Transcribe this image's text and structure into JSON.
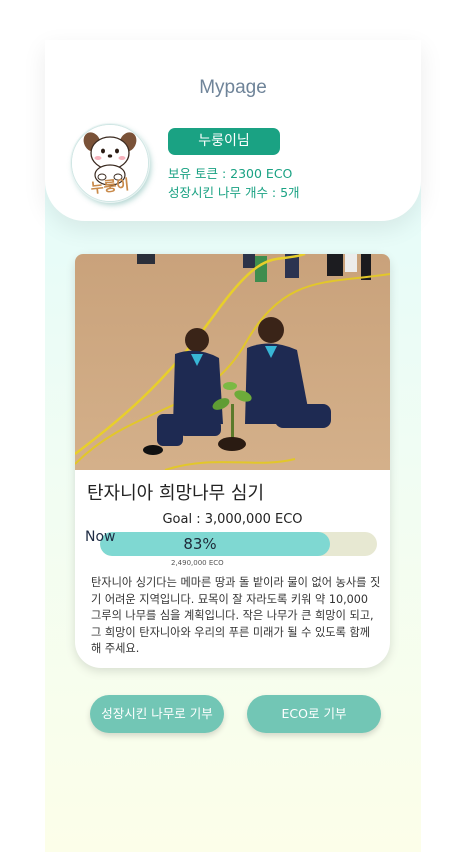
{
  "header": {
    "title": "Mypage"
  },
  "profile": {
    "name": "누룽이님",
    "avatar_icon": "dog-character-avatar",
    "avatar_caption": "누룽이",
    "token_line": "보유 토큰 : 2300 ECO",
    "tree_line": "성장시킨 나무 개수 : 5개"
  },
  "project": {
    "photo": "two-children-planting-tree-sapling",
    "title": "탄자니아 희망나무 심기",
    "goal": "Goal : 3,000,000 ECO",
    "now_label": "Now",
    "progress_text": "83%",
    "progress_value": 0.83,
    "current_amount": "2,490,000 ECO",
    "description": "탄자니아 싱기다는 메마른 땅과 돌 밭이라 물이 없어 농사를 짓기 어려운 지역입니다. 묘목이 잘 자라도록 키워 약 10,000 그루의 나무를 심을 계획입니다. 작은 나무가 큰 희망이 되고, 그 희망이 탄자니아와 우리의 푸른 미래가 될 수 있도록 함께 해 주세요."
  },
  "actions": {
    "donate_tree_label": "성장시킨 나무로 기부",
    "donate_eco_label": "ECO로 기부"
  },
  "colors": {
    "accent": "#1aa283",
    "button": "#72c6b5",
    "progress_fill": "#7fd8d2",
    "progress_track": "#e7e8d2"
  }
}
